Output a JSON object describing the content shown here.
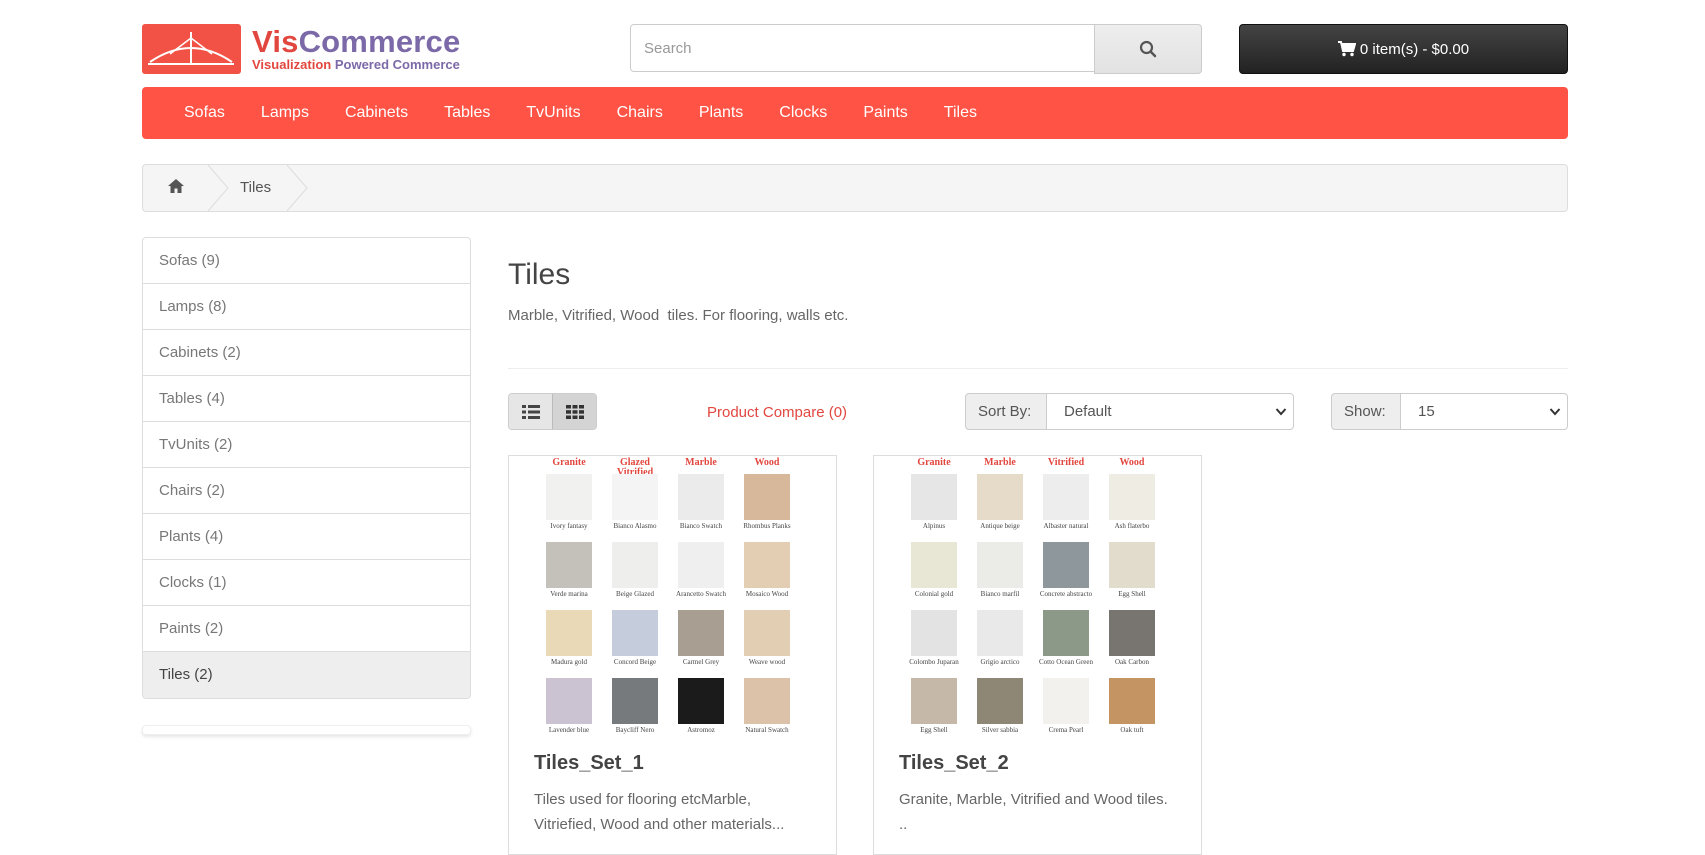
{
  "brand": {
    "name_a": "Vis",
    "name_b": "Commerce",
    "tag_a": "Visualization ",
    "tag_b": "Powered Commerce"
  },
  "search": {
    "placeholder": "Search"
  },
  "cart": {
    "label": "0 item(s) - $0.00"
  },
  "nav": [
    "Sofas",
    "Lamps",
    "Cabinets",
    "Tables",
    "TvUnits",
    "Chairs",
    "Plants",
    "Clocks",
    "Paints",
    "Tiles"
  ],
  "breadcrumb": {
    "current": "Tiles"
  },
  "sidebar": [
    "Sofas (9)",
    "Lamps (8)",
    "Cabinets (2)",
    "Tables (4)",
    "TvUnits (2)",
    "Chairs (2)",
    "Plants (4)",
    "Clocks (1)",
    "Paints (2)",
    "Tiles (2)"
  ],
  "category": {
    "title": "Tiles",
    "description": "Marble, Vitrified, Wood  tiles. For flooring, walls etc."
  },
  "toolbar": {
    "compare": "Product Compare (0)",
    "sort_label": "Sort By:",
    "sort_value": "Default",
    "show_label": "Show:",
    "show_value": "15"
  },
  "products": [
    {
      "name": "Tiles_Set_1",
      "description": "Tiles used for flooring etcMarble, Vitriefied, Wood and other materials...",
      "headers": [
        "Granite",
        "Glazed Vitrified",
        "Marble",
        "Wood"
      ],
      "swatches": [
        [
          "Ivory fantasy",
          "#f1f1ef"
        ],
        [
          "Bianco Alasmo",
          "#f4f4f4"
        ],
        [
          "Bianco Swatch",
          "#ecebeb"
        ],
        [
          "Rhombus Planks",
          "#d8b89a"
        ],
        [
          "Verde marina",
          "#c4c1bb"
        ],
        [
          "Beige Glazed",
          "#eeeeec"
        ],
        [
          "Arancetto Swatch",
          "#efefef"
        ],
        [
          "Mosaico Wood",
          "#e3cdb3"
        ],
        [
          "Madura gold",
          "#ead9b6"
        ],
        [
          "Concord Beige",
          "#c5ccdc"
        ],
        [
          "Carmel Grey",
          "#a99e92"
        ],
        [
          "Weave wood",
          "#e2cfb3"
        ],
        [
          "Lavender blue",
          "#cbc3d2"
        ],
        [
          "Baycliff Nero",
          "#777a7c"
        ],
        [
          "Astromoz",
          "#1b1b1b"
        ],
        [
          "Natural Swatch",
          "#ddc2aa"
        ]
      ]
    },
    {
      "name": "Tiles_Set_2",
      "description": "Granite, Marble, Vitrified and Wood tiles. ..",
      "headers": [
        "Granite",
        "Marble",
        "Vitrified",
        "Wood"
      ],
      "swatches": [
        [
          "Alpinus",
          "#e6e6e6"
        ],
        [
          "Antique beige",
          "#e6dac8"
        ],
        [
          "Albaster natural",
          "#ededed"
        ],
        [
          "Ash flaterbo",
          "#efece3"
        ],
        [
          "Colonial gold",
          "#e8e6d4"
        ],
        [
          "Bianco marfil",
          "#ebebe8"
        ],
        [
          "Concrete abstracto",
          "#8e979b"
        ],
        [
          "Egg Shell",
          "#e2dccd"
        ],
        [
          "Colombo Juparan",
          "#e4e3e3"
        ],
        [
          "Grigio arctico",
          "#e9e9e9"
        ],
        [
          "Cotto Ocean Green",
          "#8c9888"
        ],
        [
          "Oak Carbon",
          "#787571"
        ],
        [
          "Egg Shell",
          "#c6b8a8"
        ],
        [
          "Silver sabbia",
          "#8f8776"
        ],
        [
          "Crema Pearl",
          "#f2f1ee"
        ],
        [
          "Oak tuft",
          "#c49463"
        ]
      ]
    }
  ]
}
